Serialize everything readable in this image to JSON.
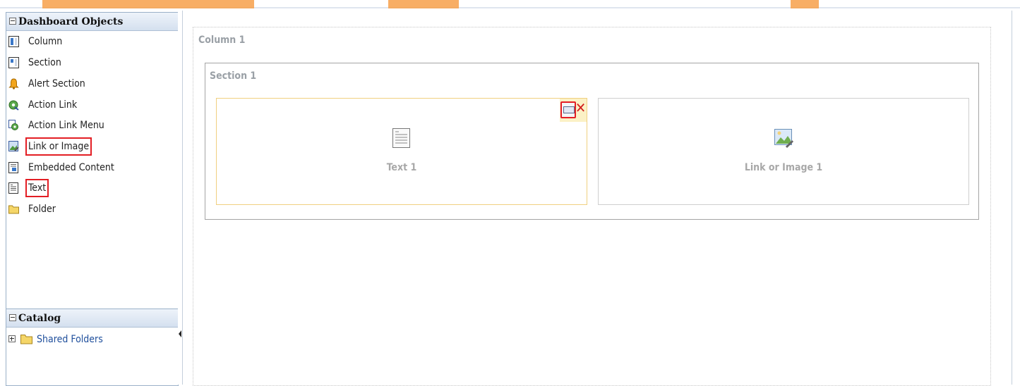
{
  "dashboard_objects": {
    "title": "Dashboard Objects",
    "items": [
      {
        "label": "Column",
        "icon": "column-icon"
      },
      {
        "label": "Section",
        "icon": "section-icon"
      },
      {
        "label": "Alert Section",
        "icon": "bell-icon"
      },
      {
        "label": "Action Link",
        "icon": "gear-icon"
      },
      {
        "label": "Action Link Menu",
        "icon": "gear-menu-icon"
      },
      {
        "label": "Link or Image",
        "icon": "link-image-icon",
        "highlighted": true
      },
      {
        "label": "Embedded Content",
        "icon": "embedded-content-icon"
      },
      {
        "label": "Text",
        "icon": "text-icon",
        "highlighted": true
      },
      {
        "label": "Folder",
        "icon": "folder-icon"
      }
    ]
  },
  "catalog": {
    "title": "Catalog",
    "items": [
      {
        "label": "Shared Folders",
        "icon": "folder-icon",
        "expanded": false
      }
    ]
  },
  "canvas": {
    "column_title": "Column 1",
    "section_title": "Section 1",
    "text_object": {
      "caption": "Text 1"
    },
    "link_object": {
      "caption": "Link or Image 1"
    }
  },
  "colors": {
    "highlight": "#e31e24",
    "accent": "#1f4f9c"
  }
}
